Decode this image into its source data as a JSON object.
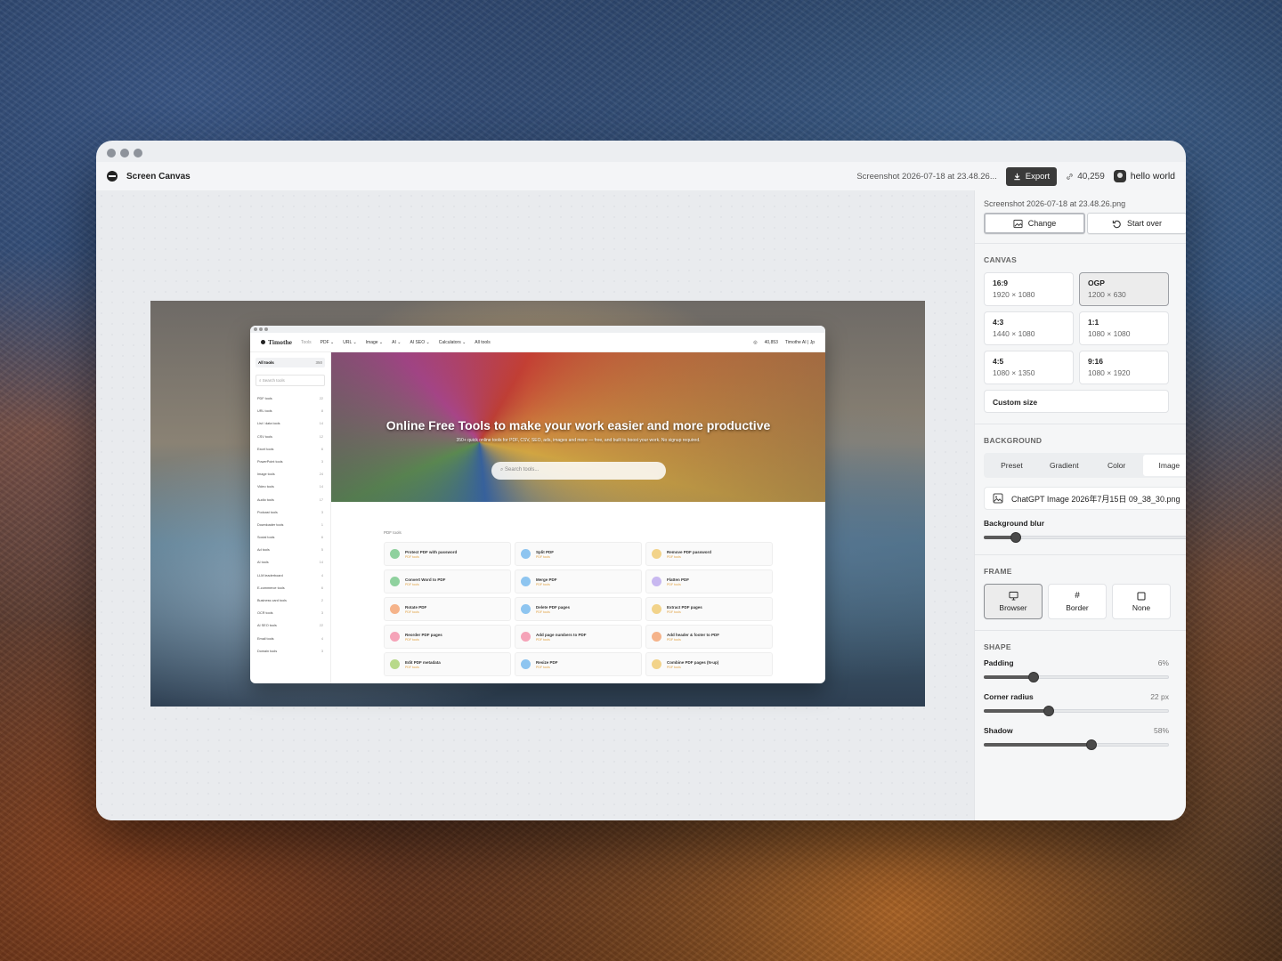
{
  "app": {
    "title": "Screen Canvas"
  },
  "header": {
    "file_name": "Screenshot 2026-07-18 at 23.48.26...",
    "export_label": "Export",
    "count": "40,259",
    "user": "hello world"
  },
  "preview": {
    "brand": "Timothe",
    "brand_tag": "Tools",
    "nav": [
      "PDF ⌄",
      "URL ⌄",
      "Image ⌄",
      "AI ⌄",
      "AI SEO ⌄",
      "Calculators ⌄",
      "All tools"
    ],
    "nav_count": "40,853",
    "nav_user": "Timothe AI | Jp",
    "sidebar_all": "All tools",
    "sidebar_all_count": "350",
    "sidebar_search": "Search tools",
    "sidebar": [
      {
        "label": "PDF tools",
        "count": "22"
      },
      {
        "label": "URL tools",
        "count": "8"
      },
      {
        "label": "List / data tools",
        "count": "14"
      },
      {
        "label": "CSV tools",
        "count": "12"
      },
      {
        "label": "Excel tools",
        "count": "6"
      },
      {
        "label": "PowerPoint tools",
        "count": "3"
      },
      {
        "label": "Image tools",
        "count": "24"
      },
      {
        "label": "Video tools",
        "count": "14"
      },
      {
        "label": "Audio tools",
        "count": "17"
      },
      {
        "label": "Podcast tools",
        "count": "3"
      },
      {
        "label": "Downloader tools",
        "count": "1"
      },
      {
        "label": "Social tools",
        "count": "6"
      },
      {
        "label": "Ad tools",
        "count": "5"
      },
      {
        "label": "AI tools",
        "count": "14"
      },
      {
        "label": "LLM leaderboard",
        "count": "4"
      },
      {
        "label": "E-commerce tools",
        "count": "6"
      },
      {
        "label": "Business card tools",
        "count": "2"
      },
      {
        "label": "OCR tools",
        "count": "3"
      },
      {
        "label": "AI SEO tools",
        "count": "22"
      },
      {
        "label": "Email tools",
        "count": "4"
      },
      {
        "label": "Domain tools",
        "count": "3"
      }
    ],
    "hero_title": "Online Free Tools to make your work easier and more productive",
    "hero_sub": "350+ quick online tools for PDF, CSV, SEO, ads, images and more — free, and built to boost your work. No signup required.",
    "hero_search": "Search tools...",
    "section_label": "PDF tools",
    "tools": [
      {
        "name": "Protect PDF with password",
        "cat": "PDF tools",
        "color": "#8fd19e"
      },
      {
        "name": "Split PDF",
        "cat": "PDF tools",
        "color": "#8ec5f0"
      },
      {
        "name": "Remove PDF password",
        "cat": "PDF tools",
        "color": "#f2d38a"
      },
      {
        "name": "Convert Word to PDF",
        "cat": "PDF tools",
        "color": "#8fd19e"
      },
      {
        "name": "Merge PDF",
        "cat": "PDF tools",
        "color": "#8ec5f0"
      },
      {
        "name": "Flatten PDF",
        "cat": "PDF tools",
        "color": "#c8b8f0"
      },
      {
        "name": "Rotate PDF",
        "cat": "PDF tools",
        "color": "#f5b38a"
      },
      {
        "name": "Delete PDF pages",
        "cat": "PDF tools",
        "color": "#8ec5f0"
      },
      {
        "name": "Extract PDF pages",
        "cat": "PDF tools",
        "color": "#f2d38a"
      },
      {
        "name": "Reorder PDF pages",
        "cat": "PDF tools",
        "color": "#f5a3b8"
      },
      {
        "name": "Add page numbers to PDF",
        "cat": "PDF tools",
        "color": "#f5a3b8"
      },
      {
        "name": "Add header & footer to PDF",
        "cat": "PDF tools",
        "color": "#f5b38a"
      },
      {
        "name": "Edit PDF metadata",
        "cat": "PDF tools",
        "color": "#b8d98a"
      },
      {
        "name": "Resize PDF",
        "cat": "PDF tools",
        "color": "#8ec5f0"
      },
      {
        "name": "Combine PDF pages (N-up)",
        "cat": "PDF tools",
        "color": "#f2d38a"
      }
    ]
  },
  "panel": {
    "file_name": "Screenshot 2026-07-18 at 23.48.26.png",
    "change_label": "Change",
    "start_over_label": "Start over",
    "canvas_heading": "CANVAS",
    "canvas_options": [
      {
        "name": "16:9",
        "size": "1920 × 1080",
        "selected": false
      },
      {
        "name": "OGP",
        "size": "1200 × 630",
        "selected": true
      },
      {
        "name": "4:3",
        "size": "1440 × 1080",
        "selected": false
      },
      {
        "name": "1:1",
        "size": "1080 × 1080",
        "selected": false
      },
      {
        "name": "4:5",
        "size": "1080 × 1350",
        "selected": false
      },
      {
        "name": "9:16",
        "size": "1080 × 1920",
        "selected": false
      }
    ],
    "custom_size_label": "Custom size",
    "background_heading": "BACKGROUND",
    "bg_tabs": [
      "Preset",
      "Gradient",
      "Color",
      "Image"
    ],
    "bg_tab_active": "Image",
    "bg_file": "ChatGPT Image 2026年7月15日 09_38_30.png",
    "bg_blur_label": "Background blur",
    "bg_blur_value": 0.15,
    "frame_heading": "FRAME",
    "frame_options": [
      {
        "label": "Browser",
        "icon": "monitor-icon",
        "selected": true
      },
      {
        "label": "Border",
        "icon": "hash-icon",
        "selected": false
      },
      {
        "label": "None",
        "icon": "square-icon",
        "selected": false
      }
    ],
    "shape_heading": "SHAPE",
    "padding_label": "Padding",
    "padding_value": "6%",
    "padding_fraction": 0.27,
    "radius_label": "Corner radius",
    "radius_value": "22 px",
    "radius_fraction": 0.35,
    "shadow_label": "Shadow",
    "shadow_value": "58%",
    "shadow_fraction": 0.58
  }
}
